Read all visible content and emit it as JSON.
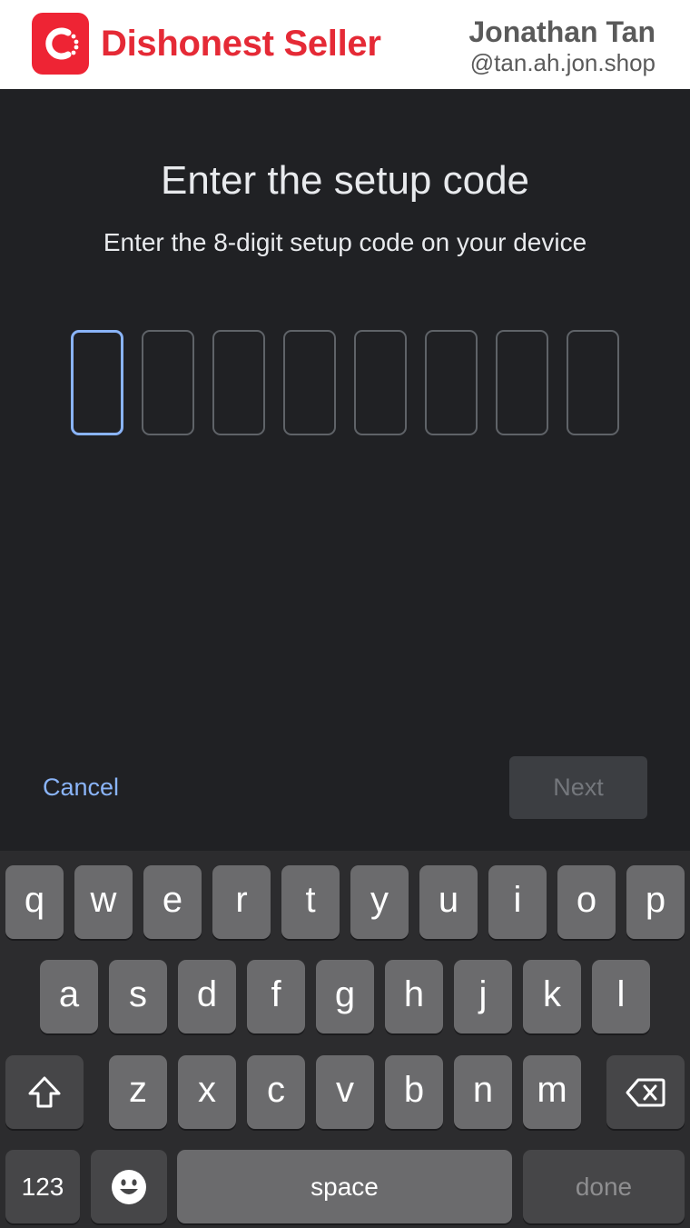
{
  "watermark": {
    "brand": "Dishonest Seller",
    "author_name": "Jonathan Tan",
    "author_handle": "@tan.ah.jon.shop",
    "logo_icon": "carousell-logo-icon"
  },
  "setup": {
    "title": "Enter the setup code",
    "subtitle": "Enter the 8-digit setup code on your device",
    "code_digits": [
      "",
      "",
      "",
      "",
      "",
      "",
      "",
      ""
    ],
    "active_index": 0
  },
  "actions": {
    "cancel_label": "Cancel",
    "next_label": "Next",
    "next_enabled": false
  },
  "keyboard": {
    "row1": [
      "q",
      "w",
      "e",
      "r",
      "t",
      "y",
      "u",
      "i",
      "o",
      "p"
    ],
    "row2": [
      "a",
      "s",
      "d",
      "f",
      "g",
      "h",
      "j",
      "k",
      "l"
    ],
    "row3": [
      "z",
      "x",
      "c",
      "v",
      "b",
      "n",
      "m"
    ],
    "shift_icon": "shift-arrow-icon",
    "backspace_icon": "backspace-icon",
    "emoji_icon": "emoji-icon",
    "numbers_label": "123",
    "space_label": "space",
    "done_label": "done"
  },
  "colors": {
    "background": "#202124",
    "accent": "#8ab4f8",
    "brand_red": "#e52a36",
    "keyboard_bg": "#2c2c2e"
  }
}
